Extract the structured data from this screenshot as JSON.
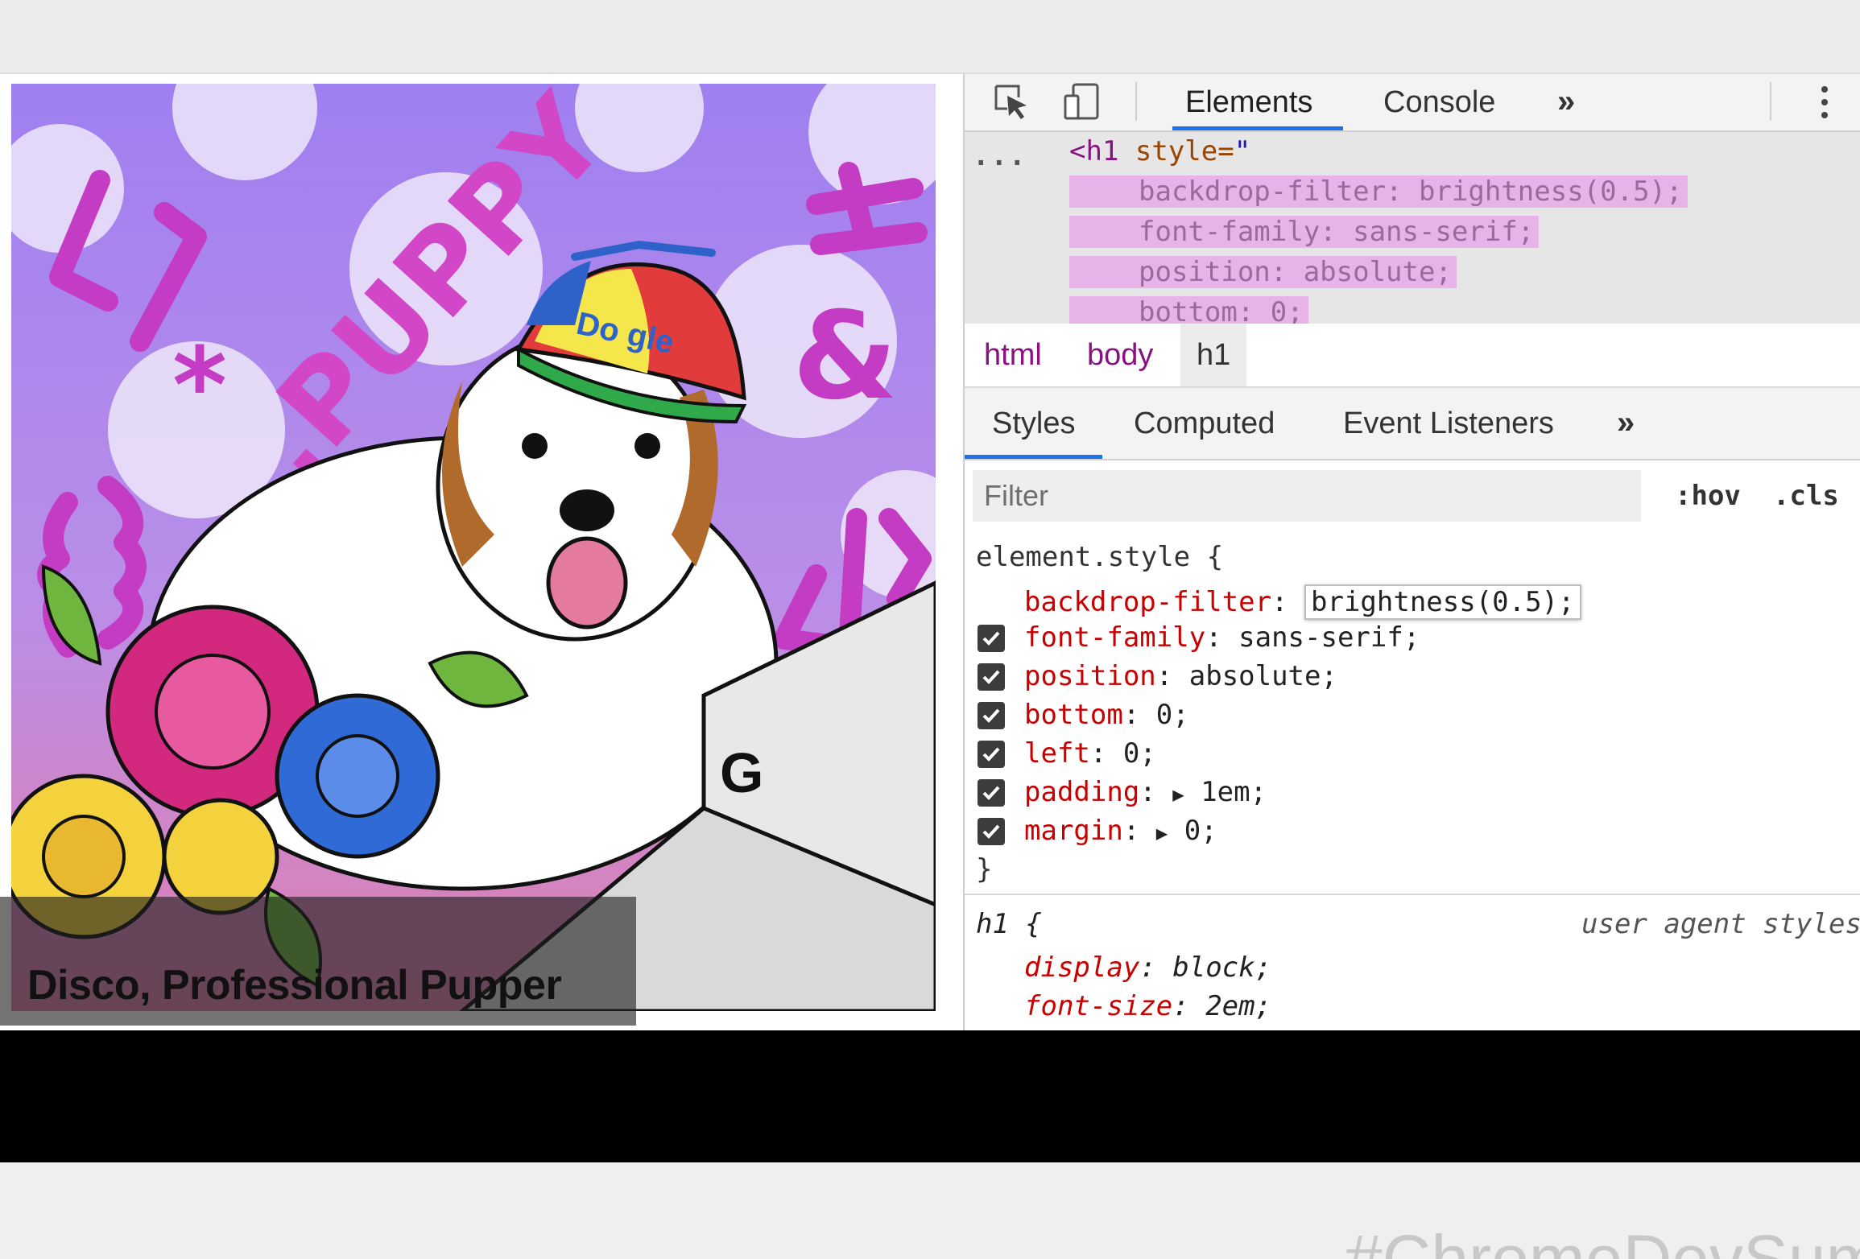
{
  "caption": "Disco, Professional Pupper",
  "artwork": {
    "word": ".PUPPY",
    "cap_text": "Do gle",
    "laptop_letter": "G",
    "symbols": [
      "[]",
      "!=",
      "&",
      "{}",
      "</>",
      "*"
    ]
  },
  "devtools": {
    "tabs": [
      "Elements",
      "Console"
    ],
    "more_tabs": "»",
    "dom": {
      "ellipsis": "...",
      "open_tag": "<h1",
      "attr_name": " style=",
      "attr_quote": "\"",
      "lines": [
        "backdrop-filter: brightness(0.5);",
        "font-family: sans-serif;",
        "position: absolute;",
        "bottom: 0;"
      ]
    },
    "breadcrumbs": [
      "html",
      "body",
      "h1"
    ],
    "sub_tabs": [
      "Styles",
      "Computed",
      "Event Listeners"
    ],
    "sub_more": "»",
    "filter_placeholder": "Filter",
    "hov": ":hov",
    "cls": ".cls",
    "element_style": {
      "selector": "element.style {",
      "editing": {
        "name": "backdrop-filter",
        "value": "brightness(0.5);"
      },
      "props": [
        {
          "name": "font-family",
          "value": "sans-serif;"
        },
        {
          "name": "position",
          "value": "absolute;"
        },
        {
          "name": "bottom",
          "value": "0;"
        },
        {
          "name": "left",
          "value": "0;"
        },
        {
          "name": "padding",
          "value": "1em;"
        },
        {
          "name": "margin",
          "value": "0;"
        }
      ],
      "close": "}"
    },
    "h1_rule": {
      "selector": "h1 {",
      "source": "user agent styles",
      "props": [
        {
          "name": "display",
          "value": "block;"
        },
        {
          "name": "font-size",
          "value": "2em;"
        }
      ]
    }
  },
  "footer_text": "#ChromeDevSummit"
}
